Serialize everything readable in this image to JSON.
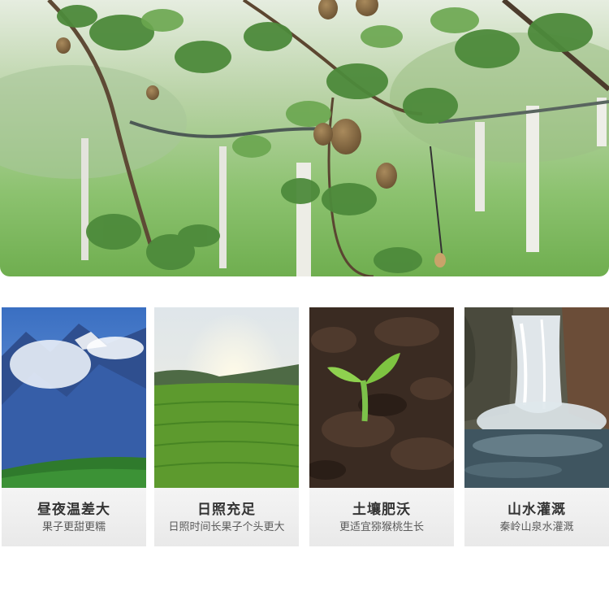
{
  "features": [
    {
      "title": "昼夜温差大",
      "subtitle": "果子更甜更糯"
    },
    {
      "title": "日照充足",
      "subtitle": "日照时间长果子个头更大"
    },
    {
      "title": "土壤肥沃",
      "subtitle": "更适宜猕猴桃生长"
    },
    {
      "title": "山水灌溉",
      "subtitle": "秦岭山泉水灌溉"
    }
  ]
}
